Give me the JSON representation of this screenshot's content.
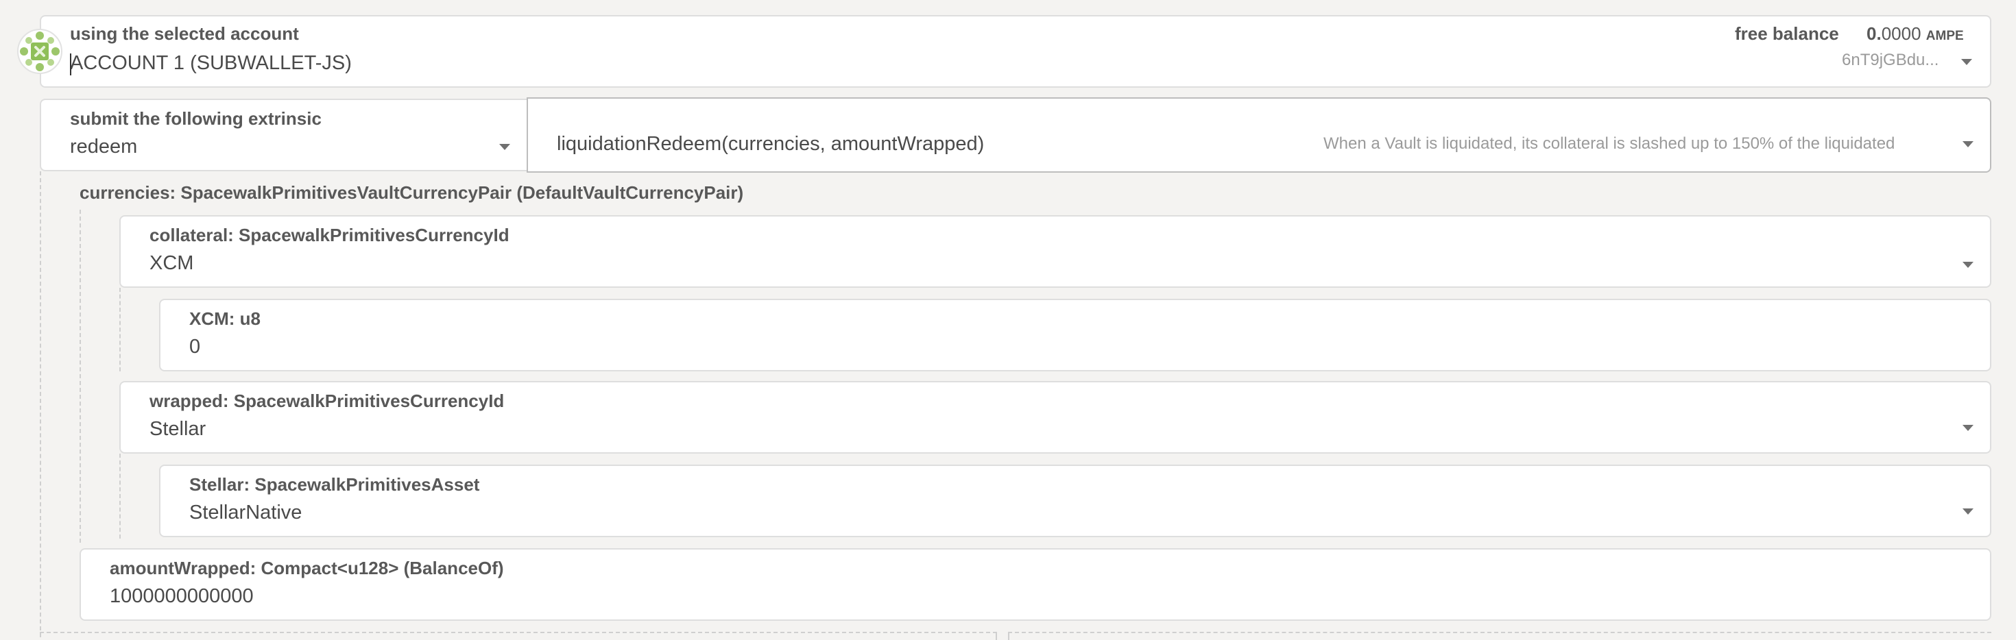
{
  "account": {
    "label": "using the selected account",
    "value": "ACCOUNT 1 (SUBWALLET-JS)",
    "balance_label": "free balance",
    "balance_int": "0.",
    "balance_dec": "0000",
    "balance_unit": "AMPE",
    "address": "6nT9jGBdu..."
  },
  "extrinsic": {
    "label": "submit the following extrinsic",
    "section": "redeem",
    "method": "liquidationRedeem(currencies, amountWrapped)",
    "description": "When a Vault is liquidated, its collateral is slashed up to 150% of the liquidated"
  },
  "params": {
    "currencies_label": "currencies: SpacewalkPrimitivesVaultCurrencyPair (DefaultVaultCurrencyPair)",
    "collateral_label": "collateral: SpacewalkPrimitivesCurrencyId",
    "collateral_value": "XCM",
    "xcm_label": "XCM: u8",
    "xcm_value": "0",
    "wrapped_label": "wrapped: SpacewalkPrimitivesCurrencyId",
    "wrapped_value": "Stellar",
    "stellar_label": "Stellar: SpacewalkPrimitivesAsset",
    "stellar_value": "StellarNative",
    "amount_label": "amountWrapped: Compact<u128> (BalanceOf)",
    "amount_value": "1000000000000"
  },
  "colors": {
    "identicon": "#8fbf58",
    "background": "#f4f3f1"
  }
}
